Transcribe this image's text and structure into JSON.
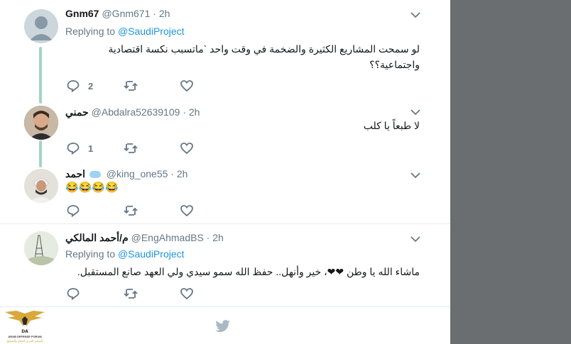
{
  "tweets": [
    {
      "name": "Gnm67",
      "handle": "@Gnm671",
      "time": "2h",
      "replying_label": "Replying to",
      "replying_to": "@SaudiProject",
      "text_line1": "لو سمحت المشاريع الكثيرة والضخمة في وقت واحد `ماتسبب نكسة اقتصادية",
      "text_line2": "واجتماعية؟؟",
      "reply_count": "2"
    },
    {
      "name": "حمني",
      "handle": "@Abdalra52639109",
      "time": "2h",
      "text": "لا طبعاً يا كلب",
      "reply_count": "1"
    },
    {
      "name": "احمد",
      "handle": "@king_one55",
      "time": "2h",
      "text": "😂😂😂😂"
    },
    {
      "name": "م/أحمد المالكي",
      "handle": "@EngAhmadBS",
      "time": "2h",
      "replying_label": "Replying to",
      "replying_to": "@SaudiProject",
      "text": "ماشاء الله يا وطن ❤❤، خير وأنهل.. حفظ الله سمو سيدي ولي العهد صانع المستقبل."
    }
  ],
  "separator": "·",
  "logo": {
    "line1": "ARAB DEFENSE FORUM",
    "line2": "المنتدى العربي للدفاع والتسليح"
  },
  "colors": {
    "accent": "#1b95e0",
    "thread_line": "#a4d3c4",
    "muted": "#657786",
    "side_panel": "#6b6e71"
  }
}
